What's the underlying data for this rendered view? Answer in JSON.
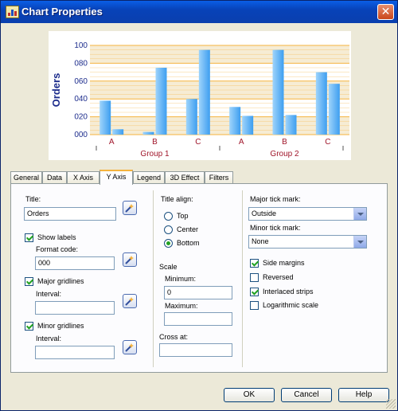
{
  "window": {
    "title": "Chart Properties",
    "close_glyph": "✕"
  },
  "chart_data": {
    "type": "bar",
    "ylabel": "Orders",
    "ylim": [
      0,
      100
    ],
    "y_ticks": [
      "000",
      "020",
      "040",
      "060",
      "080",
      "100"
    ],
    "categories": [
      "A",
      "B",
      "C",
      "A",
      "B",
      "C"
    ],
    "groups": [
      "Group 1",
      "Group 2"
    ],
    "series": [
      {
        "values": [
          38,
          3,
          40,
          31,
          95,
          70
        ]
      },
      {
        "values": [
          6,
          75,
          95,
          21,
          22,
          57
        ]
      }
    ],
    "grid": true,
    "interlaced_strips": true,
    "colors": {
      "bar": "#3d9ef0",
      "bar_light": "#9fd4fb",
      "strip": "#f6ecd4",
      "grid": "#f5b33e",
      "axis_text": "#1c2c8c",
      "group_text": "#a0152a"
    }
  },
  "tabs": [
    {
      "label": "General"
    },
    {
      "label": "Data"
    },
    {
      "label": "X Axis"
    },
    {
      "label": "Y Axis",
      "active": true
    },
    {
      "label": "Legend"
    },
    {
      "label": "3D Effect"
    },
    {
      "label": "Filters"
    }
  ],
  "left": {
    "title_label": "Title:",
    "title_value": "Orders",
    "show_labels": "Show labels",
    "format_code_label": "Format code:",
    "format_code_value": "000",
    "major_gridlines": "Major gridlines",
    "major_interval_label": "Interval:",
    "major_interval_value": "",
    "minor_gridlines": "Minor gridlines",
    "minor_interval_label": "Interval:",
    "minor_interval_value": ""
  },
  "middle": {
    "title_align_label": "Title align:",
    "align_top": "Top",
    "align_center": "Center",
    "align_bottom": "Bottom",
    "scale_label": "Scale",
    "minimum_label": "Minimum:",
    "minimum_value": "0",
    "maximum_label": "Maximum:",
    "maximum_value": "",
    "cross_at_label": "Cross at:",
    "cross_at_value": ""
  },
  "right": {
    "major_tick_label": "Major tick mark:",
    "major_tick_value": "Outside",
    "minor_tick_label": "Minor tick mark:",
    "minor_tick_value": "None",
    "side_margins": "Side margins",
    "reversed": "Reversed",
    "interlaced_strips": "Interlaced strips",
    "logarithmic_scale": "Logarithmic scale"
  },
  "buttons": {
    "ok": "OK",
    "cancel": "Cancel",
    "help": "Help"
  }
}
